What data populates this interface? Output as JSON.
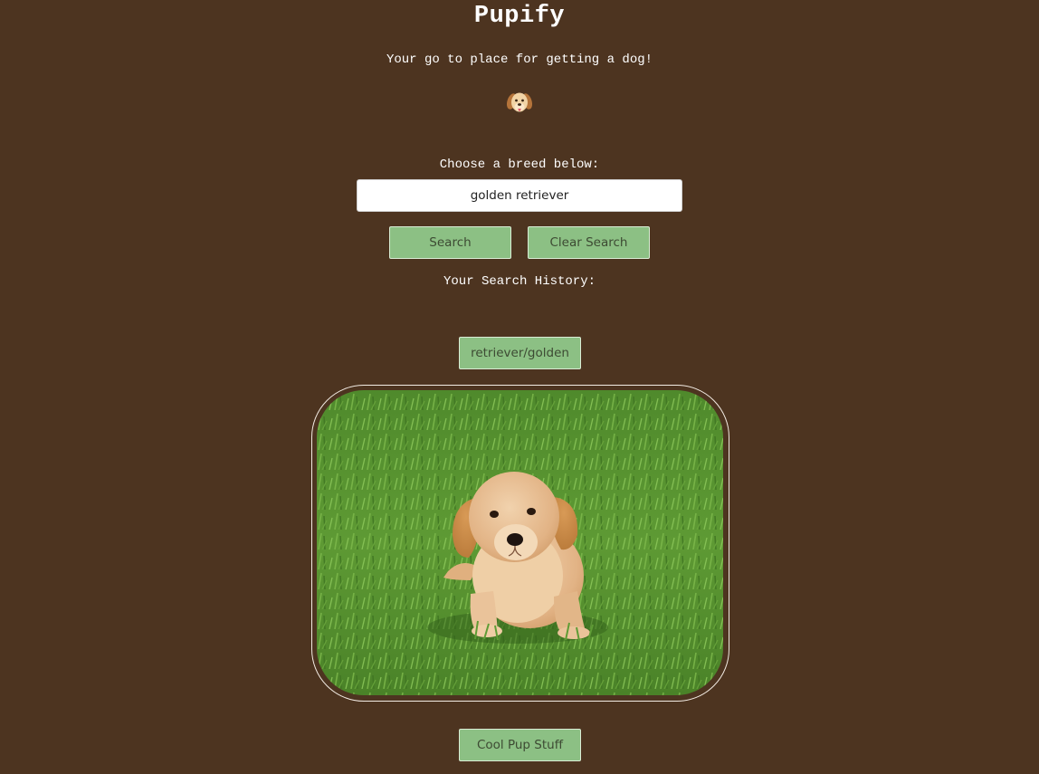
{
  "app": {
    "title": "Pupify",
    "tagline": "Your go to place for getting a dog!",
    "logo_icon": "dog-face-icon"
  },
  "search": {
    "label": "Choose a breed below:",
    "value": "golden retriever",
    "search_button": "Search",
    "clear_button": "Clear Search"
  },
  "history": {
    "label": "Your Search History:",
    "items": [
      {
        "label": "retriever/golden"
      }
    ]
  },
  "result": {
    "image_subject": "golden retriever puppy lying on grass"
  },
  "footer": {
    "cool_button": "Cool Pup Stuff"
  },
  "colors": {
    "background": "#4d3420",
    "button": "#8cc084",
    "button_text": "#3d4a33",
    "text": "#ffffff"
  }
}
